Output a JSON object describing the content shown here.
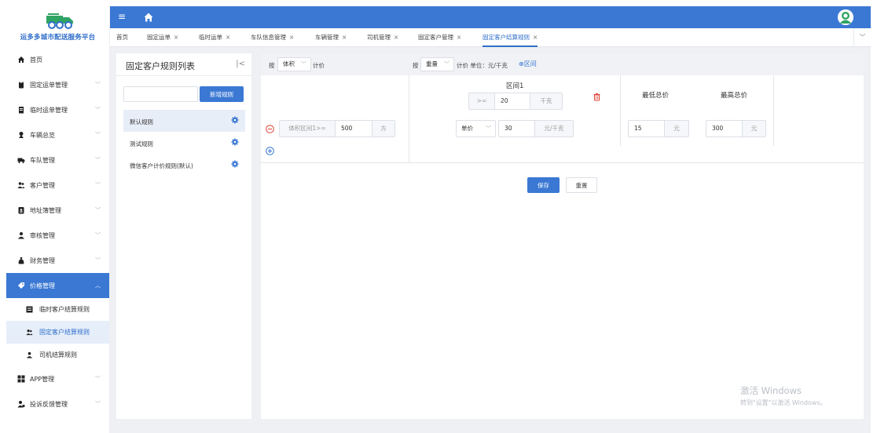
{
  "brand": {
    "title": "运多多城市配送服务平台"
  },
  "sidebar": {
    "items": [
      {
        "label": "首页",
        "icon": "home-icon"
      },
      {
        "label": "固定运单管理",
        "icon": "clipboard-icon"
      },
      {
        "label": "临时运单管理",
        "icon": "document-icon"
      },
      {
        "label": "车辆总览",
        "icon": "location-pin-icon"
      },
      {
        "label": "车队管理",
        "icon": "truck-icon"
      },
      {
        "label": "客户管理",
        "icon": "users-icon"
      },
      {
        "label": "地址簿管理",
        "icon": "address-book-icon"
      },
      {
        "label": "审核管理",
        "icon": "user-icon"
      },
      {
        "label": "财务管理",
        "icon": "money-bag-icon"
      },
      {
        "label": "价格管理",
        "icon": "tag-icon"
      },
      {
        "label": "APP管理",
        "icon": "grid-icon"
      },
      {
        "label": "投诉反馈管理",
        "icon": "user-feedback-icon"
      }
    ],
    "sub_items": [
      {
        "label": "临时客户结算规则",
        "icon": "list-icon"
      },
      {
        "label": "固定客户结算规则",
        "icon": "users-icon"
      },
      {
        "label": "司机结算规则",
        "icon": "user-icon"
      }
    ]
  },
  "tabs": [
    {
      "label": "首页",
      "close": ""
    },
    {
      "label": "固定运单",
      "close": "×"
    },
    {
      "label": "临时运单",
      "close": "×"
    },
    {
      "label": "车队信息管理",
      "close": "×"
    },
    {
      "label": "车辆管理",
      "close": "×"
    },
    {
      "label": "司机管理",
      "close": "×"
    },
    {
      "label": "固定客户管理",
      "close": "×"
    },
    {
      "label": "固定客户结算规则",
      "close": "×"
    }
  ],
  "rules_panel": {
    "title": "固定客户规则列表",
    "search_placeholder": "",
    "new_rule_label": "新增规则",
    "rules": [
      "默认规则",
      "测试规则",
      "微信客户计价规则(默认)"
    ]
  },
  "config": {
    "by_label_1": "按",
    "by_select_1": "体积",
    "pricing_label_1": "计价",
    "by_label_2": "按",
    "by_select_2": "重量",
    "pricing_label_2": "计价 单位：元/千克",
    "add_range_label": "区间",
    "range_title": "区间1",
    "range_op": ">=",
    "range_value": "20",
    "range_unit": "千克",
    "volume_prefix": "体积区间1>=",
    "volume_value": "500",
    "volume_unit": "方",
    "unit_price_select": "单价",
    "unit_price_value": "30",
    "unit_price_unit": "元/千克",
    "min_total_title": "最低总价",
    "max_total_title": "最高总价",
    "min_total_value": "15",
    "min_total_unit": "元",
    "max_total_value": "300",
    "max_total_unit": "元",
    "save_label": "保存",
    "reset_label": "重置"
  },
  "watermark": {
    "line1": "激活 Windows",
    "line2": "转到\"设置\"以激活 Windows。"
  },
  "colors": {
    "primary": "#3a78d4",
    "danger": "#e0473b",
    "accent_green": "#2fa463"
  }
}
